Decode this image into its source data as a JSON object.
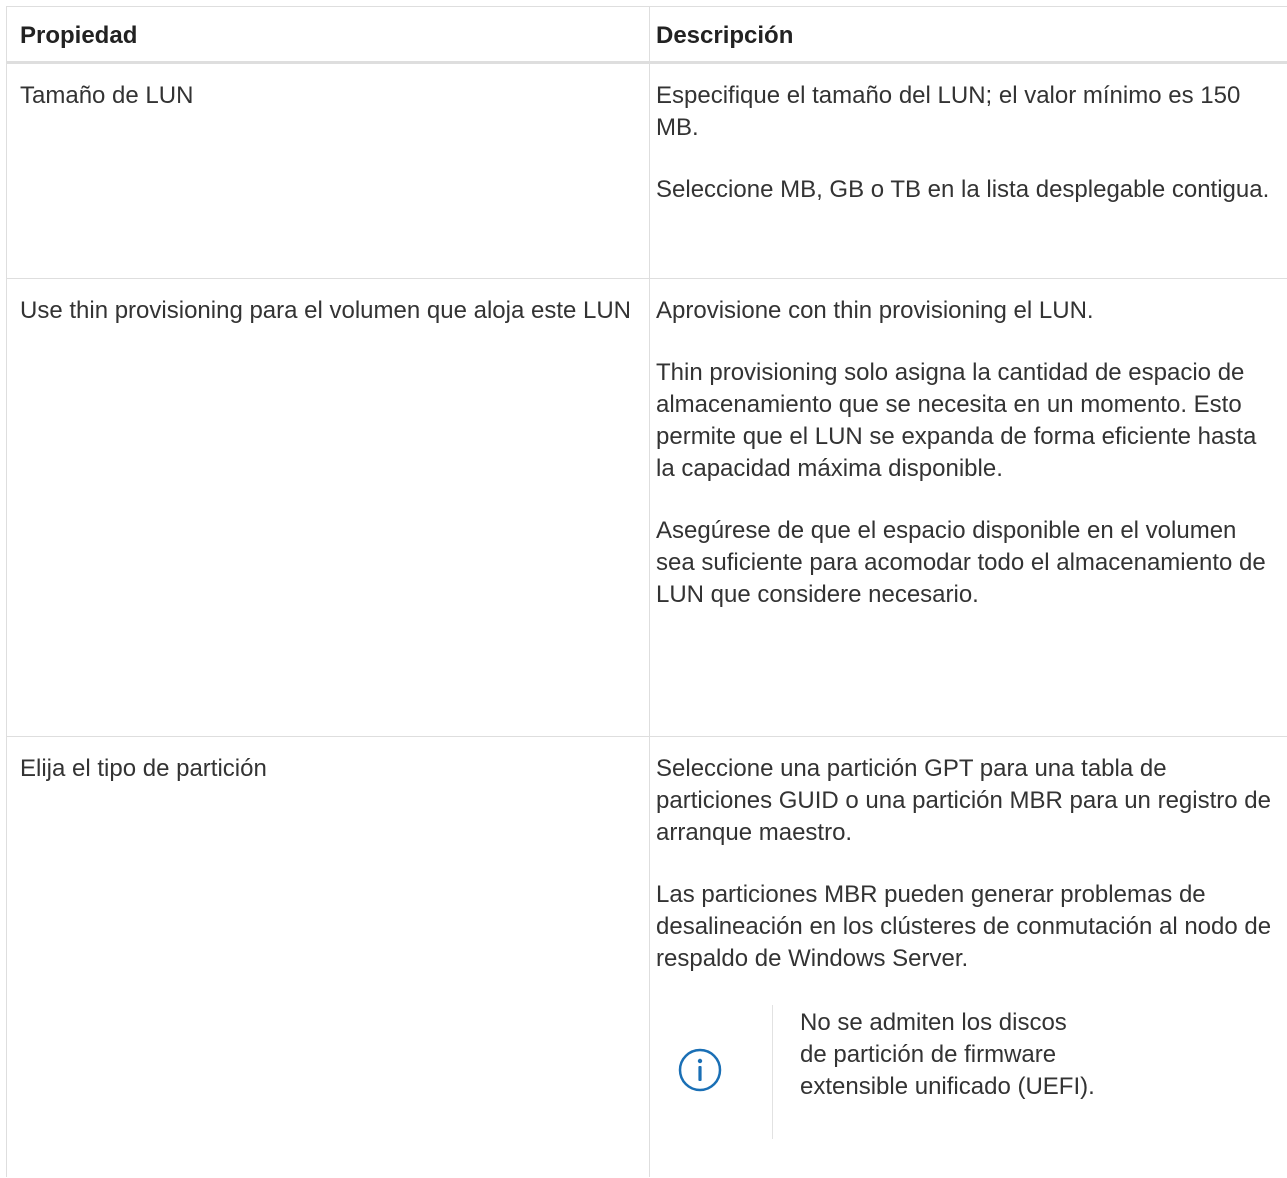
{
  "table": {
    "headers": {
      "property": "Propiedad",
      "description": "Descripción"
    },
    "rows": [
      {
        "property": "Tamaño de LUN",
        "description": [
          "Especifique el tamaño del LUN; el valor mínimo es 150 MB.",
          "Seleccione MB, GB o TB en la lista desplegable contigua."
        ]
      },
      {
        "property": "Use thin provisioning para el volumen que aloja este LUN",
        "description": [
          "Aprovisione con thin provisioning el LUN.",
          "Thin provisioning solo asigna la cantidad de espacio de almacenamiento que se necesita en un momento. Esto permite que el LUN se expanda de forma eficiente hasta la capacidad máxima disponible.",
          "Asegúrese de que el espacio disponible en el volumen sea suficiente para acomodar todo el almacenamiento de LUN que considere necesario."
        ]
      },
      {
        "property": "Elija el tipo de partición",
        "description": [
          "Seleccione una partición GPT para una tabla de particiones GUID o una partición MBR para un registro de arranque maestro.",
          "Las particiones MBR pueden generar problemas de desalineación en los clústeres de conmutación al nodo de respaldo de Windows Server."
        ],
        "note": {
          "icon": "info-circle-icon",
          "text": "No se admiten los discos de partición de firmware extensible unificado (UEFI)."
        }
      }
    ]
  },
  "colors": {
    "border": "#dedede",
    "text": "#333333",
    "icon": "#1a6fb5"
  }
}
